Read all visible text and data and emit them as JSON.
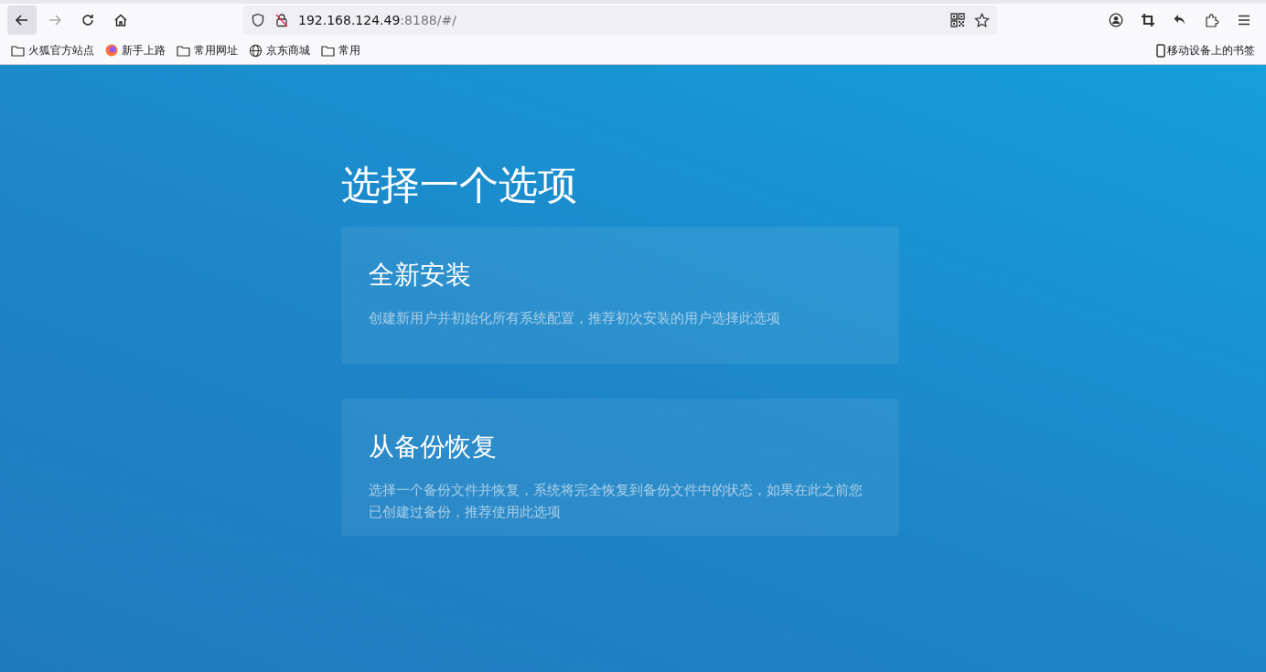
{
  "browser": {
    "nav_buttons": [
      {
        "kind": "back",
        "disabled": false
      },
      {
        "kind": "forward",
        "disabled": true
      },
      {
        "kind": "reload",
        "disabled": false
      },
      {
        "kind": "home",
        "disabled": false
      }
    ],
    "address": {
      "host": "192.168.124.49",
      "rest": ":8188/#/"
    },
    "bookmarks": [
      {
        "kind": "folder",
        "label": "火狐官方站点"
      },
      {
        "kind": "firefox",
        "label": "新手上路"
      },
      {
        "kind": "folder",
        "label": "常用网址"
      },
      {
        "kind": "globe",
        "label": "京东商城"
      },
      {
        "kind": "folder",
        "label": "常用"
      }
    ],
    "mobile_bookmarks": "移动设备上的书签"
  },
  "page": {
    "title": "选择一个选项",
    "options": [
      {
        "title": "全新安装",
        "description": "创建新用户并初始化所有系统配置，推荐初次安装的用户选择此选项"
      },
      {
        "title": "从备份恢复",
        "description": "选择一个备份文件并恢复，系统将完全恢复到备份文件中的状态，如果在此之前您已创建过备份，推荐使用此选项"
      }
    ]
  }
}
